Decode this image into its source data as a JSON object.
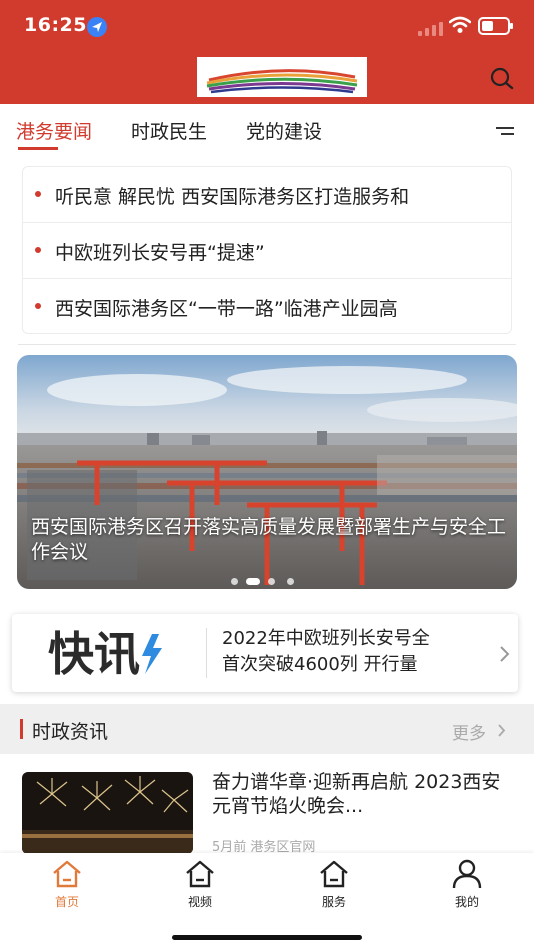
{
  "status_bar": {
    "time": "16:25"
  },
  "header": {
    "logo_icon": "port-logo-arcs",
    "search_icon": "search-icon"
  },
  "colors": {
    "brand_red": "#d03b2e",
    "active_tab": "#e07a3a"
  },
  "tabs": [
    {
      "label": "港务要闻",
      "active": true
    },
    {
      "label": "时政民生",
      "active": false
    },
    {
      "label": "党的建设",
      "active": false
    }
  ],
  "headlines": [
    {
      "text": "听民意 解民忧 西安国际港务区打造服务和"
    },
    {
      "text": "中欧班列长安号再“提速”"
    },
    {
      "text": "西安国际港务区“一带一路”临港产业园高"
    }
  ],
  "banner": {
    "caption": "西安国际港务区召开落实高质量发展暨部署生产与安全工作会议",
    "slide_count": 4,
    "active_slide": 2
  },
  "flash": {
    "logo_text": "快讯",
    "line1": "2022年中欧班列长安号全",
    "line2": "首次突破4600列 开行量"
  },
  "section": {
    "title": "时政资讯",
    "more_label": "更多"
  },
  "news": [
    {
      "title": "奋力谱华章·迎新再启航 2023西安元宵节焰火晚会...",
      "time": "5月前",
      "source": "港务区官网"
    }
  ],
  "tabbar": [
    {
      "label": "首页",
      "icon": "home-icon",
      "active": true
    },
    {
      "label": "视频",
      "icon": "home-icon",
      "active": false
    },
    {
      "label": "服务",
      "icon": "home-icon",
      "active": false
    },
    {
      "label": "我的",
      "icon": "person-icon",
      "active": false
    }
  ]
}
